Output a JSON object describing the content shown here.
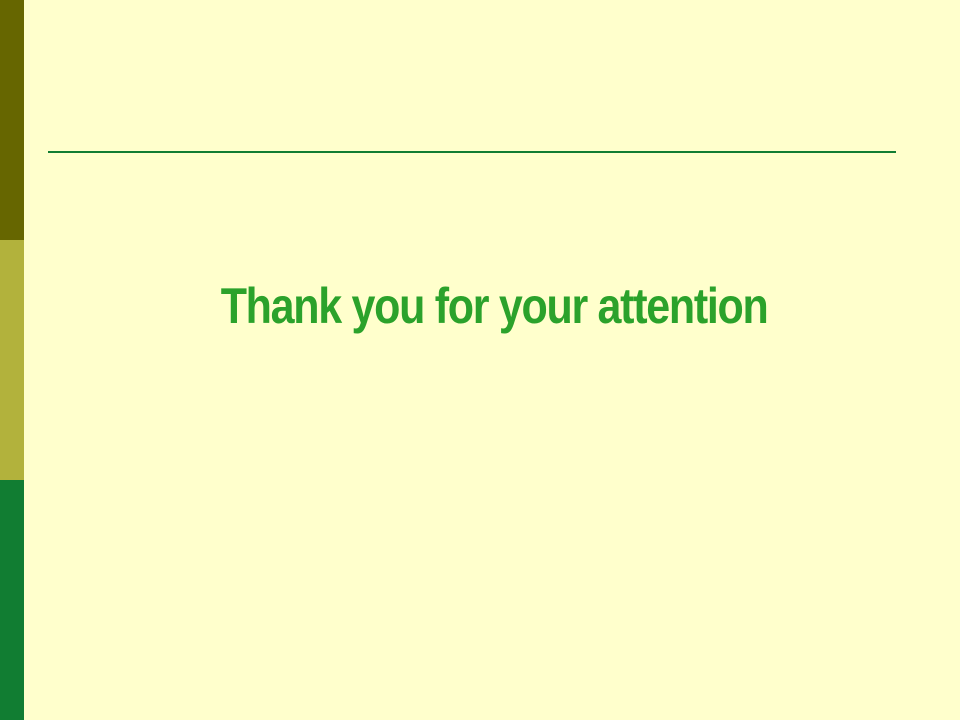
{
  "slide": {
    "title": "Thank you for your attention"
  },
  "colors": {
    "background": "#FFFFCC",
    "bar_top": "#666600",
    "bar_middle": "#B2B23C",
    "bar_bottom": "#117D32",
    "rule": "#117D32",
    "title": "#2BA22B"
  }
}
